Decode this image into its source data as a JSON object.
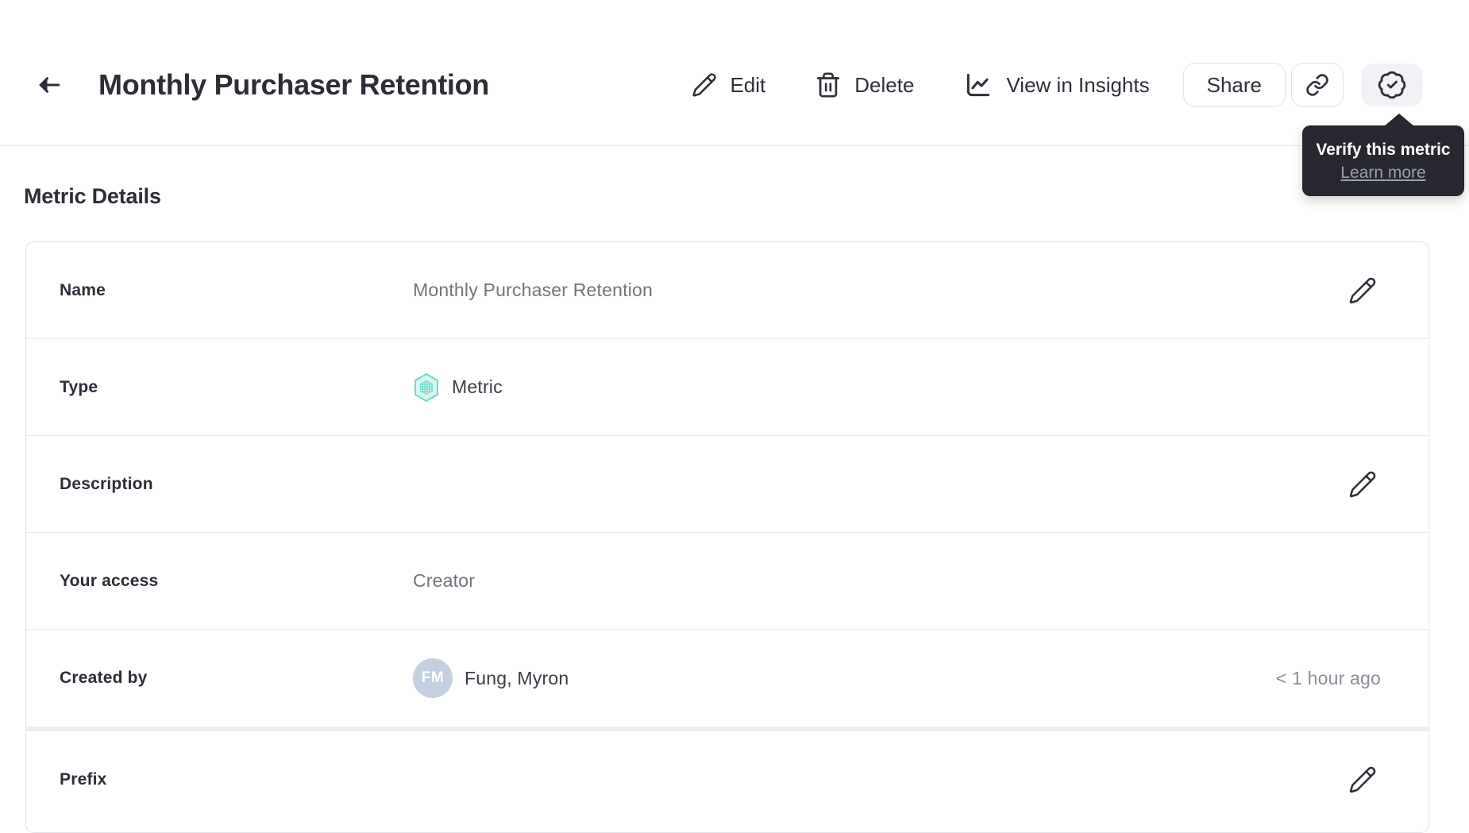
{
  "colors": {
    "ink": "#2d3039",
    "muted_text": "#70737c",
    "accent_teal": "#6edccb",
    "teal_fill": "#d8f5f0",
    "avatar_bg": "#c4d0df",
    "tooltip_bg": "#27272f",
    "verify_button_bg": "#f2f2f6",
    "card_border": "#e4e4e8"
  },
  "header": {
    "title": "Monthly Purchaser Retention",
    "actions": {
      "edit": {
        "label": "Edit",
        "icon": "pencil-icon"
      },
      "delete": {
        "label": "Delete",
        "icon": "trash-icon"
      },
      "insights": {
        "label": "View in Insights",
        "icon": "line-chart-icon"
      },
      "share": {
        "label": "Share"
      },
      "copy_link": {
        "icon": "link-icon"
      },
      "verify": {
        "icon": "verified-badge-icon"
      }
    }
  },
  "tooltip": {
    "title": "Verify this metric",
    "link_label": "Learn more"
  },
  "metric_details": {
    "section_title": "Metric Details",
    "rows": {
      "name": {
        "label": "Name",
        "value": "Monthly Purchaser Retention"
      },
      "type": {
        "label": "Type",
        "value": "Metric",
        "icon": "metric-hexagon-icon"
      },
      "description": {
        "label": "Description",
        "value": ""
      },
      "access": {
        "label": "Your access",
        "value": "Creator"
      },
      "created_by": {
        "label": "Created by",
        "value": "Fung, Myron",
        "avatar_initials": "FM",
        "timestamp": "< 1 hour ago"
      },
      "prefix": {
        "label": "Prefix",
        "value": ""
      }
    }
  }
}
